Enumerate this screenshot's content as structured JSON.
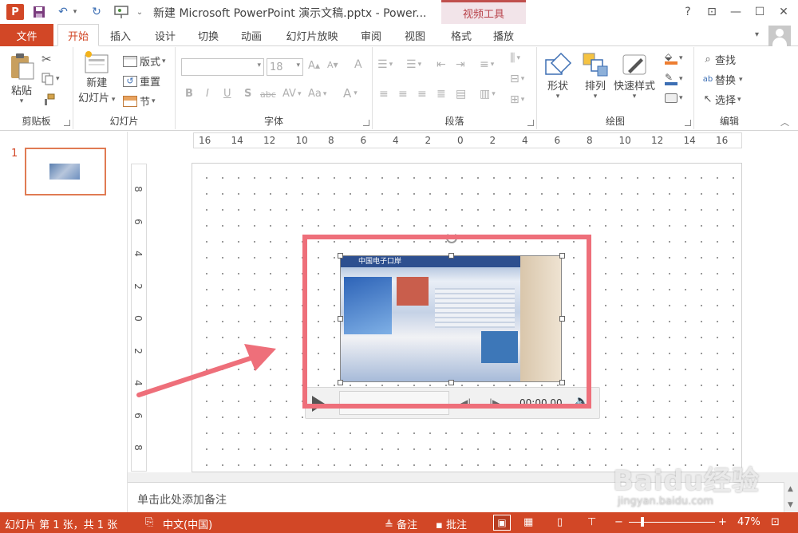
{
  "titlebar": {
    "app_icon": "P",
    "save_icon": "save-icon",
    "undo_icon": "undo-icon",
    "redo_icon": "redo-icon",
    "present_icon": "presentation-icon",
    "more": "⌄",
    "title": "新建 Microsoft PowerPoint 演示文稿.pptx - Power...",
    "context_group": "视频工具",
    "help": "?",
    "restore_ribbon": "⊡",
    "minimize": "—",
    "maximize": "☐",
    "close": "✕"
  },
  "tabs": {
    "file": "文件",
    "items": [
      "开始",
      "插入",
      "设计",
      "切换",
      "动画",
      "幻灯片放映",
      "审阅",
      "视图",
      "格式",
      "播放"
    ],
    "active": "开始"
  },
  "ribbon": {
    "clipboard": {
      "paste": "粘贴",
      "label": "剪贴板"
    },
    "slides": {
      "new_slide_line1": "新建",
      "new_slide_line2": "幻灯片",
      "layout": "版式",
      "reset": "重置",
      "section": "节",
      "label": "幻灯片"
    },
    "font": {
      "font_size": "18",
      "bold": "B",
      "italic": "I",
      "underline": "U",
      "shadow": "S",
      "strike": "abc",
      "spacing": "AV",
      "case": "Aa",
      "color": "A",
      "grow": "A",
      "shrink": "A",
      "clear": "A",
      "label": "字体"
    },
    "paragraph": {
      "label": "段落"
    },
    "drawing": {
      "shapes": "形状",
      "arrange": "排列",
      "quick_styles": "快速样式",
      "label": "绘图"
    },
    "editing": {
      "find": "查找",
      "replace": "替换",
      "select": "选择",
      "label": "编辑"
    }
  },
  "thumbnails": [
    {
      "number": "1"
    }
  ],
  "ruler": {
    "horizontal": [
      "16",
      "14",
      "12",
      "10",
      "8",
      "6",
      "4",
      "2",
      "0",
      "2",
      "4",
      "6",
      "8",
      "10",
      "12",
      "14",
      "16"
    ],
    "vertical": [
      "8",
      "6",
      "4",
      "2",
      "0",
      "2",
      "4",
      "6",
      "8"
    ]
  },
  "video": {
    "header_text": "中国电子口岸",
    "time": "00:00.00"
  },
  "notes": {
    "placeholder": "单击此处添加备注"
  },
  "statusbar": {
    "slide_info": "幻灯片 第 1 张，共 1 张",
    "language": "中文(中国)",
    "notes_btn": "备注",
    "comments_btn": "批注",
    "zoom_minus": "−",
    "zoom_plus": "+",
    "zoom": "47%"
  },
  "watermark": {
    "text": "Baidu经验",
    "url": "jingyan.baidu.com"
  },
  "colors": {
    "accent": "#d24726",
    "highlight": "#ee6f7a",
    "context_tab": "#b8424a"
  }
}
